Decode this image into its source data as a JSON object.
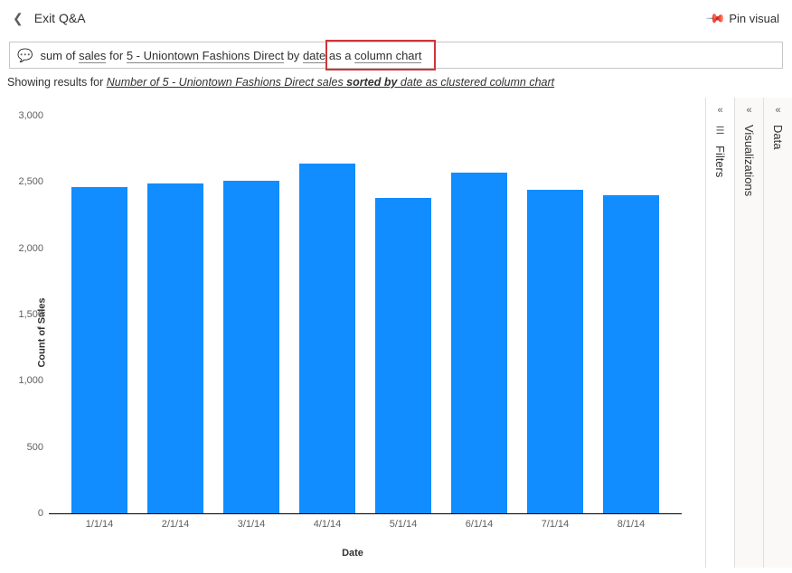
{
  "header": {
    "exit_label": "Exit Q&A",
    "pin_label": "Pin visual"
  },
  "query": {
    "p1": "sum of ",
    "p2_u": "sales",
    "p3": " for ",
    "p4_u": "5 - Uniontown Fashions Direct",
    "p5": " by ",
    "p6_u": "date",
    "p7": " as a ",
    "p8_u": "column chart"
  },
  "result": {
    "prefix": "Showing results for ",
    "italic1": "Number of 5 - Uniontown Fashions Direct sales ",
    "bold1": "sorted by",
    "italic2": " date as clustered column chart"
  },
  "panels": {
    "filters": "Filters",
    "visualizations": "Visualizations",
    "data": "Data"
  },
  "chart_data": {
    "type": "bar",
    "title": "",
    "xlabel": "Date",
    "ylabel": "Count of Sales",
    "ylim": [
      0,
      3000
    ],
    "yticks": [
      0,
      500,
      1000,
      1500,
      2000,
      2500,
      3000
    ],
    "ytick_labels": [
      "0",
      "500",
      "1,000",
      "1,500",
      "2,000",
      "2,500",
      "3,000"
    ],
    "categories": [
      "1/1/14",
      "2/1/14",
      "3/1/14",
      "4/1/14",
      "5/1/14",
      "6/1/14",
      "7/1/14",
      "8/1/14"
    ],
    "values": [
      2460,
      2490,
      2510,
      2640,
      2380,
      2570,
      2440,
      2400
    ]
  }
}
